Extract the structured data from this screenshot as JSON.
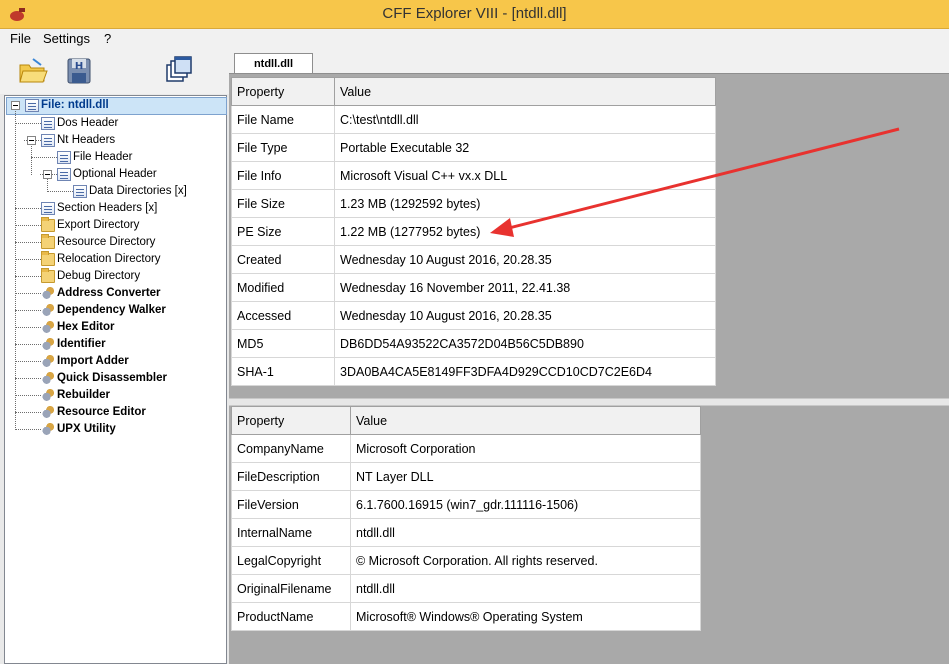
{
  "window": {
    "title": "CFF Explorer VIII - [ntdll.dll]"
  },
  "menu": {
    "items": [
      "File",
      "Settings",
      "?"
    ]
  },
  "toolbar": {
    "icons": [
      "open-folder-icon",
      "save-disk-icon",
      "windows-icon"
    ]
  },
  "tree": {
    "root": "File: ntdll.dll",
    "items": [
      {
        "label": "Dos Header",
        "icon": "doc-icon"
      },
      {
        "label": "Nt Headers",
        "icon": "doc-icon"
      },
      {
        "label": "File Header",
        "icon": "doc-icon"
      },
      {
        "label": "Optional Header",
        "icon": "doc-icon"
      },
      {
        "label": "Data Directories [x]",
        "icon": "doc-icon"
      },
      {
        "label": "Section Headers [x]",
        "icon": "doc-icon"
      },
      {
        "label": "Export Directory",
        "icon": "folder-icon"
      },
      {
        "label": "Resource Directory",
        "icon": "folder-icon"
      },
      {
        "label": "Relocation Directory",
        "icon": "folder-icon"
      },
      {
        "label": "Debug Directory",
        "icon": "folder-icon"
      },
      {
        "label": "Address Converter",
        "icon": "tool-icon"
      },
      {
        "label": "Dependency Walker",
        "icon": "tool-icon"
      },
      {
        "label": "Hex Editor",
        "icon": "tool-icon"
      },
      {
        "label": "Identifier",
        "icon": "tool-icon"
      },
      {
        "label": "Import Adder",
        "icon": "tool-icon"
      },
      {
        "label": "Quick Disassembler",
        "icon": "tool-icon"
      },
      {
        "label": "Rebuilder",
        "icon": "tool-icon"
      },
      {
        "label": "Resource Editor",
        "icon": "tool-icon"
      },
      {
        "label": "UPX Utility",
        "icon": "tool-icon"
      }
    ]
  },
  "tab": {
    "label": "ntdll.dll"
  },
  "file_table": {
    "headers": [
      "Property",
      "Value"
    ],
    "rows": [
      [
        "File Name",
        "C:\\test\\ntdll.dll"
      ],
      [
        "File Type",
        "Portable Executable 32"
      ],
      [
        "File Info",
        "Microsoft Visual C++ vx.x DLL"
      ],
      [
        "File Size",
        "1.23 MB (1292592 bytes)"
      ],
      [
        "PE Size",
        "1.22 MB (1277952 bytes)"
      ],
      [
        "Created",
        "Wednesday 10 August 2016, 20.28.35"
      ],
      [
        "Modified",
        "Wednesday 16 November 2011, 22.41.38"
      ],
      [
        "Accessed",
        "Wednesday 10 August 2016, 20.28.35"
      ],
      [
        "MD5",
        "DB6DD54A93522CA3572D04B56C5DB890"
      ],
      [
        "SHA-1",
        "3DA0BA4CA5E8149FF3DFA4D929CCD10CD7C2E6D4"
      ]
    ]
  },
  "version_table": {
    "headers": [
      "Property",
      "Value"
    ],
    "rows": [
      [
        "CompanyName",
        "Microsoft Corporation"
      ],
      [
        "FileDescription",
        "NT Layer DLL"
      ],
      [
        "FileVersion",
        "6.1.7600.16915 (win7_gdr.111116-1506)"
      ],
      [
        "InternalName",
        "ntdll.dll"
      ],
      [
        "LegalCopyright",
        "© Microsoft Corporation. All rights reserved."
      ],
      [
        "OriginalFilename",
        "ntdll.dll"
      ],
      [
        "ProductName",
        "Microsoft® Windows® Operating System"
      ]
    ]
  },
  "annotation": {
    "color": "#e8322f",
    "points_to": "PE Size"
  },
  "colors": {
    "titlebar": "#f7c64a",
    "selection": "#cce4f7",
    "workspace": "#a9a9a9"
  }
}
